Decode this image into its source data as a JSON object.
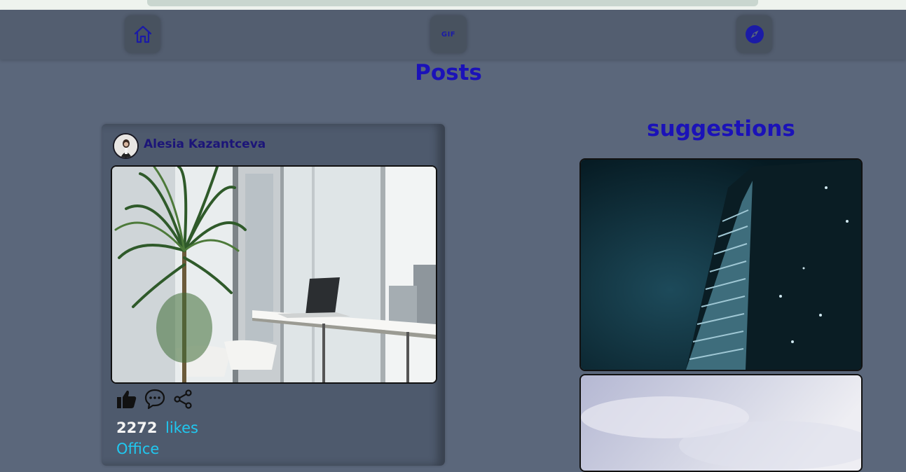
{
  "nav": {
    "home_icon": "home-icon",
    "gif_label": "GIF",
    "explore_icon": "compass-icon"
  },
  "page": {
    "title": "Posts"
  },
  "post": {
    "author": "Alesia Kazantceva",
    "likes_count": "2272",
    "likes_label": "likes",
    "caption": "Office",
    "actions": [
      "thumbs-up-icon",
      "comment-icon",
      "share-icon"
    ]
  },
  "suggestions": {
    "title": "suggestions"
  },
  "colors": {
    "background": "#5b677b",
    "title": "#1b12b8",
    "accent": "#20c8f0",
    "nav_icon": "#1b1ba6"
  }
}
